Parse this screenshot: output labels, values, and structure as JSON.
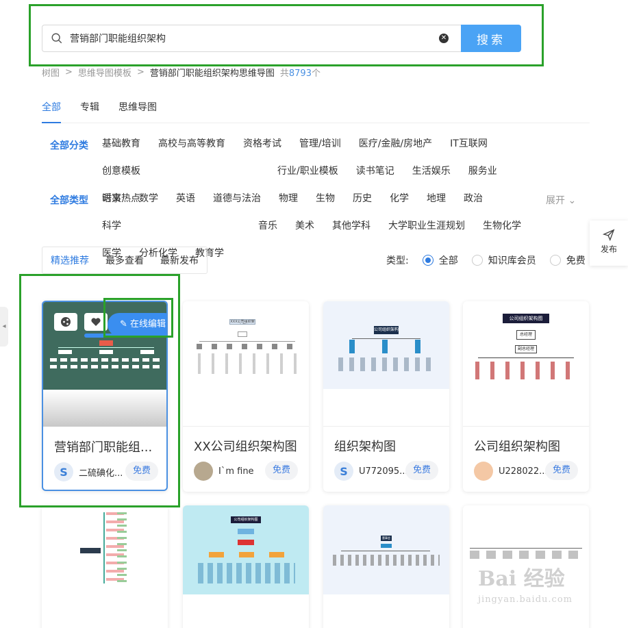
{
  "search": {
    "value": "营销部门职能组织架构",
    "button": "搜索"
  },
  "breadcrumb": {
    "items": [
      "树图",
      "思维导图模板",
      "营销部门职能组织架构思维导图"
    ],
    "count_prefix": "共",
    "count": "8793",
    "count_suffix": "个"
  },
  "tabs": [
    "全部",
    "专辑",
    "思维导图"
  ],
  "categories": {
    "label": "全部分类",
    "items": [
      "基础教育",
      "高校与高等教育",
      "资格考试",
      "管理/培训",
      "医疗/金融/房地产",
      "IT互联网",
      "创意模板",
      "行业/职业模板",
      "读书笔记",
      "生活娱乐",
      "服务业",
      "时事热点"
    ]
  },
  "types": {
    "label": "全部类型",
    "items": [
      "语文",
      "数学",
      "英语",
      "道德与法治",
      "物理",
      "生物",
      "历史",
      "化学",
      "地理",
      "政治",
      "科学",
      "音乐",
      "美术",
      "其他学科",
      "大学职业生涯规划",
      "生物化学",
      "医学",
      "分析化学",
      "教育学"
    ],
    "expand": "展开"
  },
  "sort": [
    "精选推荐",
    "最多查看",
    "最新发布"
  ],
  "type_filter": {
    "label": "类型:",
    "options": [
      "全部",
      "知识库会员",
      "免费"
    ]
  },
  "publish": "发布",
  "cards": [
    {
      "title": "营销部门职能组...",
      "author": "二硫碘化...",
      "badge": "免费",
      "edit": "在线编辑"
    },
    {
      "title": "XX公司组织架构图",
      "author": "I`m fine",
      "badge": "免费"
    },
    {
      "title": "组织架构图",
      "author": "U772095...",
      "badge": "免费"
    },
    {
      "title": "公司组织架构图",
      "author": "U228022...",
      "badge": "免费"
    }
  ],
  "thumb_text": {
    "c2": "XXX公司组织架构图",
    "c3": "公司组织架构",
    "c4": "公司组织架构图",
    "c4_a": "总经理",
    "c4_b": "副总经理",
    "r2_c2": "公司组织架构图",
    "r2_c3": "董事会"
  },
  "watermark": {
    "main": "Bai 经验",
    "sub": "jingyan.baidu.com"
  },
  "colors": {
    "accent": "#2e7be0",
    "search_btn": "#4aa3f5",
    "highlight": "#2aa12a"
  }
}
